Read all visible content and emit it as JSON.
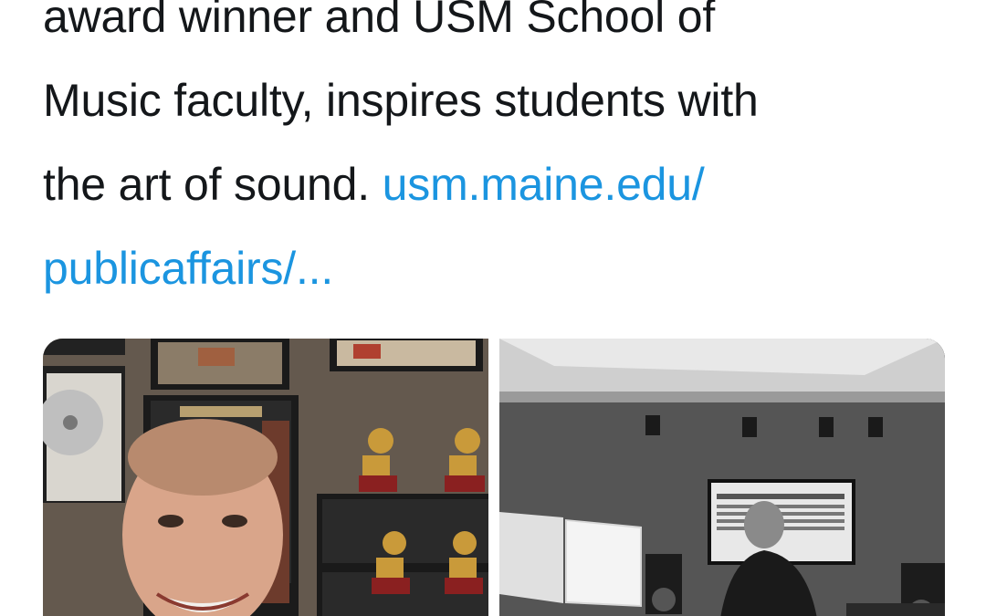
{
  "tweet": {
    "text_lines": [
      "award winner and USM School of",
      "Music faculty, inspires students with",
      "the art of sound. "
    ],
    "link_line1": "usm.maine.edu/",
    "link_line2": "publicaffairs/...",
    "link_color": "#1b95e0",
    "text_color": "#14171a"
  },
  "media": [
    {
      "description_icon": "photo-man-with-grammy-awards"
    },
    {
      "description_icon": "photo-recording-studio-black-and-white"
    }
  ]
}
